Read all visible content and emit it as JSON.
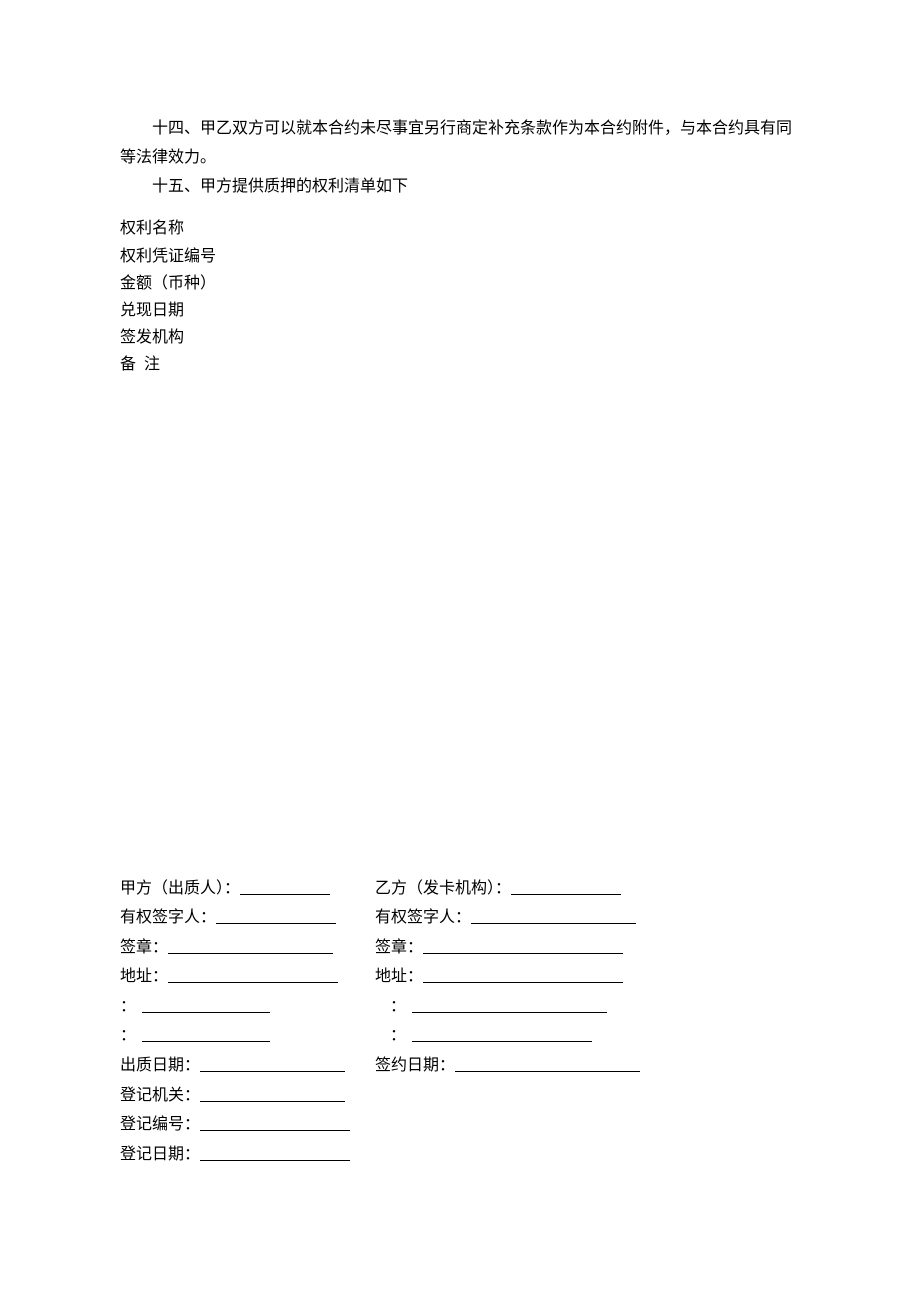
{
  "paragraphs": {
    "p14": "十四、甲乙双方可以就本合约未尽事宜另行商定补充条款作为本合约附件，与本合约具有同等法律效力。",
    "p15": "十五、甲方提供质押的权利清单如下"
  },
  "rights_list": {
    "name": "权利名称",
    "cert_no": "权利凭证编号",
    "amount": "金额（币种）",
    "date": "兑现日期",
    "issuer": "签发机构",
    "note_label_a": "备",
    "note_label_b": "注"
  },
  "signature": {
    "party_a": "甲方（出质人）：",
    "party_b": "乙方（发卡机构）：",
    "signer": "有权签字人：",
    "seal": "签章：",
    "address": "地址：",
    "colon": "：",
    "pledge_date": "出质日期：",
    "sign_date": "签约日期：",
    "reg_org": "登记机关：",
    "reg_no": "登记编号：",
    "reg_date": "登记日期："
  }
}
